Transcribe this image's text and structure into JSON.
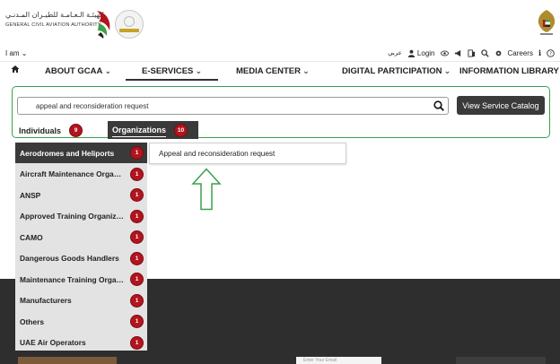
{
  "header": {
    "org_name_ar": "الهيئـة الـعـامـة للطيـران المـدنـي",
    "org_name_en": "GENERAL CIVIL AVIATION AUTHORITY"
  },
  "utility": {
    "iam_label": "I am",
    "arabic_label": "عربي",
    "login_label": "Login",
    "careers_label": "Careers"
  },
  "nav": {
    "items": [
      {
        "label": "ABOUT GCAA"
      },
      {
        "label": "E-SERVICES"
      },
      {
        "label": "MEDIA CENTER"
      },
      {
        "label": "DIGITAL PARTICIPATION"
      },
      {
        "label": "INFORMATION LIBRARY"
      }
    ],
    "active_index": 1
  },
  "search": {
    "value": "appeal and reconsideration request",
    "catalog_button": "View Service Catalog"
  },
  "tabs": {
    "individuals": {
      "label": "Individuals",
      "count": "9"
    },
    "organizations": {
      "label": "Organizations",
      "count": "10"
    }
  },
  "categories": [
    {
      "label": "Aerodromes and Heliports",
      "count": "1"
    },
    {
      "label": "Aircraft Maintenance Organizations",
      "count": "1"
    },
    {
      "label": "ANSP",
      "count": "1"
    },
    {
      "label": "Approved Training Organizations",
      "count": "1"
    },
    {
      "label": "CAMO",
      "count": "1"
    },
    {
      "label": "Dangerous Goods Handlers",
      "count": "1"
    },
    {
      "label": "Maintenance Training Organizations",
      "count": "1"
    },
    {
      "label": "Manufacturers",
      "count": "1"
    },
    {
      "label": "Others",
      "count": "1"
    },
    {
      "label": "UAE Air Operators",
      "count": "1"
    }
  ],
  "result": {
    "label": "Appeal and reconsideration request"
  },
  "footer": {
    "email_placeholder": "Enter Your Email"
  },
  "colors": {
    "accent_green": "#3aa14a",
    "badge_red": "#b3141d",
    "dark": "#3a3a3a"
  }
}
